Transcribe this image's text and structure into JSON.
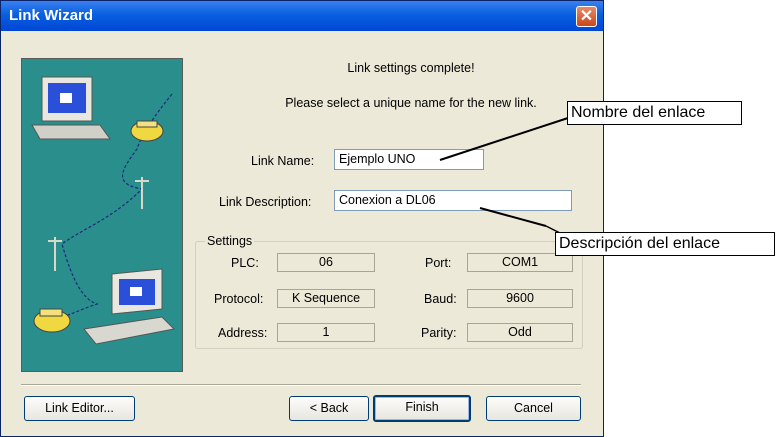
{
  "window": {
    "title": "Link Wizard"
  },
  "messages": {
    "complete": "Link settings complete!",
    "instruction": "Please select a unique name for the new link."
  },
  "fields": {
    "link_name_label": "Link Name:",
    "link_name_value": "Ejemplo UNO",
    "link_description_label": "Link Description:",
    "link_description_value": "Conexion a DL06"
  },
  "settings": {
    "title": "Settings",
    "plc_label": "PLC:",
    "plc_value": "06",
    "protocol_label": "Protocol:",
    "protocol_value": "K Sequence",
    "address_label": "Address:",
    "address_value": "1",
    "port_label": "Port:",
    "port_value": "COM1",
    "baud_label": "Baud:",
    "baud_value": "9600",
    "parity_label": "Parity:",
    "parity_value": "Odd"
  },
  "buttons": {
    "link_editor": "Link Editor...",
    "back": "< Back",
    "finish": "Finish",
    "cancel": "Cancel"
  },
  "annotations": {
    "name_callout": "Nombre del enlace",
    "description_callout": "Descripción del enlace"
  },
  "colors": {
    "titlebar": "#0a5fe0",
    "dialog_bg": "#ece9d8",
    "graphic_bg": "#2a8f8c"
  }
}
